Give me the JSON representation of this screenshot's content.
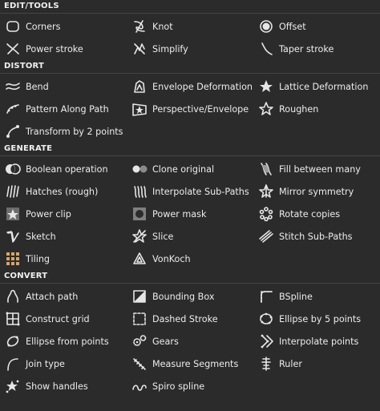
{
  "sections": [
    {
      "title": "EDIT/TOOLS",
      "items": [
        {
          "label": "Corners",
          "icon": "corners-icon"
        },
        {
          "label": "Knot",
          "icon": "knot-icon"
        },
        {
          "label": "Offset",
          "icon": "offset-icon"
        },
        {
          "label": "Power stroke",
          "icon": "power-stroke-icon"
        },
        {
          "label": "Simplify",
          "icon": "simplify-icon"
        },
        {
          "label": "Taper stroke",
          "icon": "taper-stroke-icon"
        }
      ]
    },
    {
      "title": "DISTORT",
      "items": [
        {
          "label": "Bend",
          "icon": "bend-icon"
        },
        {
          "label": "Envelope Deformation",
          "icon": "envelope-deformation-icon"
        },
        {
          "label": "Lattice Deformation",
          "icon": "lattice-deformation-icon"
        },
        {
          "label": "Pattern Along Path",
          "icon": "pattern-along-path-icon"
        },
        {
          "label": "Perspective/Envelope",
          "icon": "perspective-envelope-icon"
        },
        {
          "label": "Roughen",
          "icon": "roughen-icon"
        },
        {
          "label": "Transform by 2 points",
          "icon": "transform-2-points-icon"
        }
      ]
    },
    {
      "title": "GENERATE",
      "items": [
        {
          "label": "Boolean operation",
          "icon": "boolean-operation-icon"
        },
        {
          "label": "Clone original",
          "icon": "clone-original-icon"
        },
        {
          "label": "Fill between many",
          "icon": "fill-between-many-icon"
        },
        {
          "label": "Hatches (rough)",
          "icon": "hatches-icon"
        },
        {
          "label": "Interpolate Sub-Paths",
          "icon": "interpolate-subpaths-icon"
        },
        {
          "label": "Mirror symmetry",
          "icon": "mirror-symmetry-icon"
        },
        {
          "label": "Power clip",
          "icon": "power-clip-icon"
        },
        {
          "label": "Power mask",
          "icon": "power-mask-icon"
        },
        {
          "label": "Rotate copies",
          "icon": "rotate-copies-icon"
        },
        {
          "label": "Sketch",
          "icon": "sketch-icon"
        },
        {
          "label": "Slice",
          "icon": "slice-icon"
        },
        {
          "label": "Stitch Sub-Paths",
          "icon": "stitch-subpaths-icon"
        },
        {
          "label": "Tiling",
          "icon": "tiling-icon"
        },
        {
          "label": "VonKoch",
          "icon": "vonkoch-icon"
        }
      ]
    },
    {
      "title": "CONVERT",
      "items": [
        {
          "label": "Attach path",
          "icon": "attach-path-icon"
        },
        {
          "label": "Bounding Box",
          "icon": "bounding-box-icon"
        },
        {
          "label": "BSpline",
          "icon": "bspline-icon"
        },
        {
          "label": "Construct grid",
          "icon": "construct-grid-icon"
        },
        {
          "label": "Dashed Stroke",
          "icon": "dashed-stroke-icon"
        },
        {
          "label": "Ellipse by 5 points",
          "icon": "ellipse-5-points-icon"
        },
        {
          "label": "Ellipse from points",
          "icon": "ellipse-from-points-icon"
        },
        {
          "label": "Gears",
          "icon": "gears-icon"
        },
        {
          "label": "Interpolate points",
          "icon": "interpolate-points-icon"
        },
        {
          "label": "Join type",
          "icon": "join-type-icon"
        },
        {
          "label": "Measure Segments",
          "icon": "measure-segments-icon"
        },
        {
          "label": "Ruler",
          "icon": "ruler-icon"
        },
        {
          "label": "Show handles",
          "icon": "show-handles-icon"
        },
        {
          "label": "Spiro spline",
          "icon": "spiro-spline-icon"
        }
      ]
    }
  ],
  "colors": {
    "background": "#2b2b2b",
    "text": "#ececec",
    "icon": "#e6e6e6",
    "divider": "#444444"
  }
}
